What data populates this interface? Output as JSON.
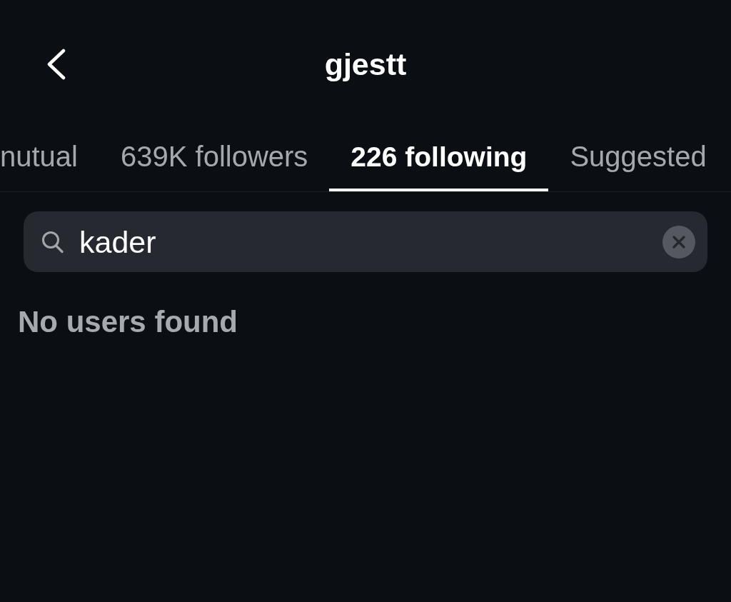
{
  "header": {
    "title": "gjestt"
  },
  "tabs": [
    {
      "label": "nutual",
      "selected": false
    },
    {
      "label": "639K followers",
      "selected": false
    },
    {
      "label": "226 following",
      "selected": true
    },
    {
      "label": "Suggested",
      "selected": false
    }
  ],
  "search": {
    "value": "kader"
  },
  "results": {
    "message": "No users found"
  }
}
